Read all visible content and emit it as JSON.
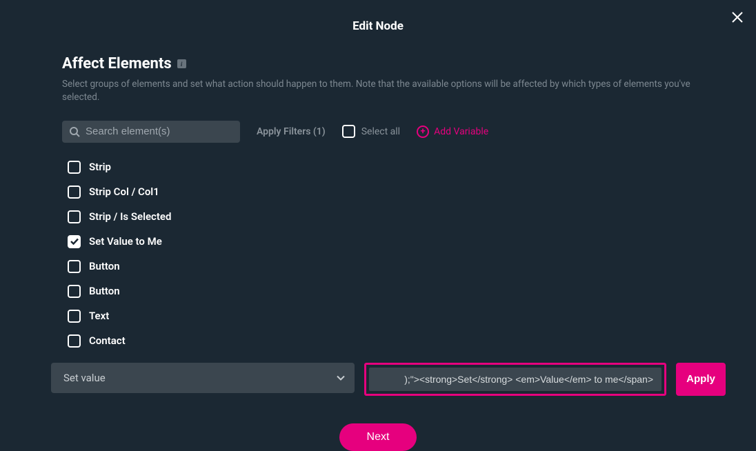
{
  "modal": {
    "title": "Edit Node"
  },
  "section": {
    "heading": "Affect Elements",
    "info_label": "i",
    "description": "Select groups of elements and set what action should happen to them. Note that the available options will be affected by which types of elements you've selected."
  },
  "search": {
    "placeholder": "Search element(s)"
  },
  "filters": {
    "apply_label": "Apply Filters (1)",
    "select_all_label": "Select all",
    "add_variable_label": "Add Variable"
  },
  "elements": [
    {
      "label": "Strip",
      "checked": false
    },
    {
      "label": "Strip Col / Col1",
      "checked": false
    },
    {
      "label": "Strip / Is Selected",
      "checked": false
    },
    {
      "label": "Set Value to Me",
      "checked": true
    },
    {
      "label": "Button",
      "checked": false
    },
    {
      "label": "Button",
      "checked": false
    },
    {
      "label": "Text",
      "checked": false
    },
    {
      "label": "Contact",
      "checked": false
    }
  ],
  "action": {
    "select_label": "Set value",
    "input_value": ");\"><strong>Set</strong> <em>Value</em> to me</span>",
    "apply_label": "Apply"
  },
  "footer": {
    "next_label": "Next"
  }
}
